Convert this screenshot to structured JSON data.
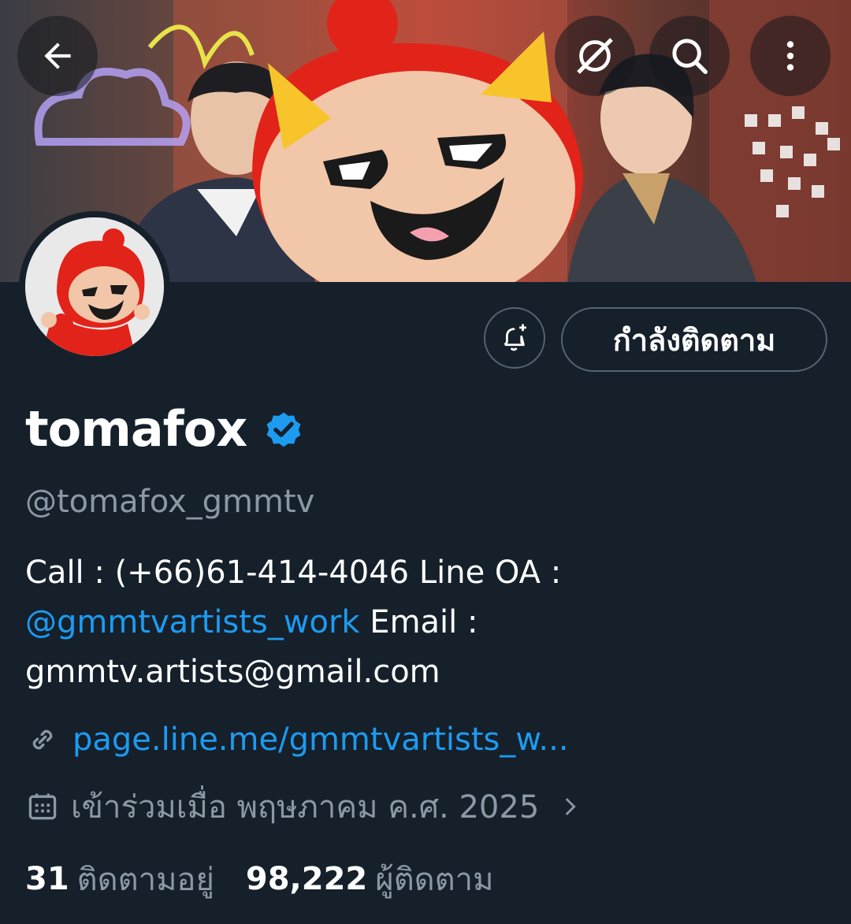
{
  "header": {
    "back_icon": "arrow-left-icon",
    "grok_icon": "grok-icon",
    "search_icon": "search-icon",
    "more_icon": "more-vertical-icon"
  },
  "profile": {
    "display_name": "tomafox",
    "handle": "@tomafox_gmmtv",
    "verified": true,
    "bio_part1": "Call : (+66)61-414-4046 Line OA : ",
    "bio_mention": "@gmmtvartists_work",
    "bio_part2": " Email : gmmtv.artists@gmail.com",
    "link": "page.line.me/gmmtvartists_w...",
    "joined": "เข้าร่วมเมื่อ พฤษภาคม ค.ศ. 2025",
    "following_count": "31",
    "following_label": "ติดตามอยู่",
    "followers_count": "98,222",
    "followers_label": "ผู้ติดตาม"
  },
  "actions": {
    "follow_label": "กำลังติดตาม",
    "notify_icon": "bell-plus-icon"
  },
  "colors": {
    "background": "#15202b",
    "accent": "#1d9bf0",
    "muted": "#8b98a5",
    "border": "#536471"
  }
}
